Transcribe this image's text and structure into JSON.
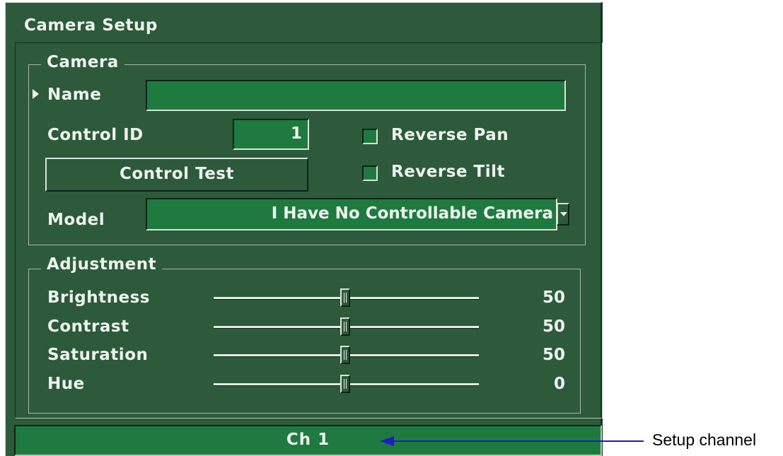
{
  "window": {
    "title": "Camera Setup"
  },
  "camera": {
    "legend": "Camera",
    "name_label": "Name",
    "name_value": "",
    "control_id_label": "Control ID",
    "control_id_value": "1",
    "reverse_pan_label": "Reverse Pan",
    "reverse_pan_checked": false,
    "reverse_tilt_label": "Reverse Tilt",
    "reverse_tilt_checked": false,
    "control_test_label": "Control Test",
    "model_label": "Model",
    "model_value": "I Have No Controllable Camera"
  },
  "adjustment": {
    "legend": "Adjustment",
    "sliders": [
      {
        "label": "Brightness",
        "value": "50"
      },
      {
        "label": "Contrast",
        "value": "50"
      },
      {
        "label": "Saturation",
        "value": "50"
      },
      {
        "label": "Hue",
        "value": "0"
      }
    ]
  },
  "status": {
    "channel": "Ch 1"
  },
  "annotation": {
    "text": "Setup channel",
    "color": "#1c1cc8"
  },
  "colors": {
    "background": "#2c5a3b",
    "field": "#1f7a40",
    "text": "#eef3ee"
  },
  "icons": [
    "current-row-pointer-icon",
    "dropdown-arrow-icon",
    "annotation-arrow-icon"
  ]
}
